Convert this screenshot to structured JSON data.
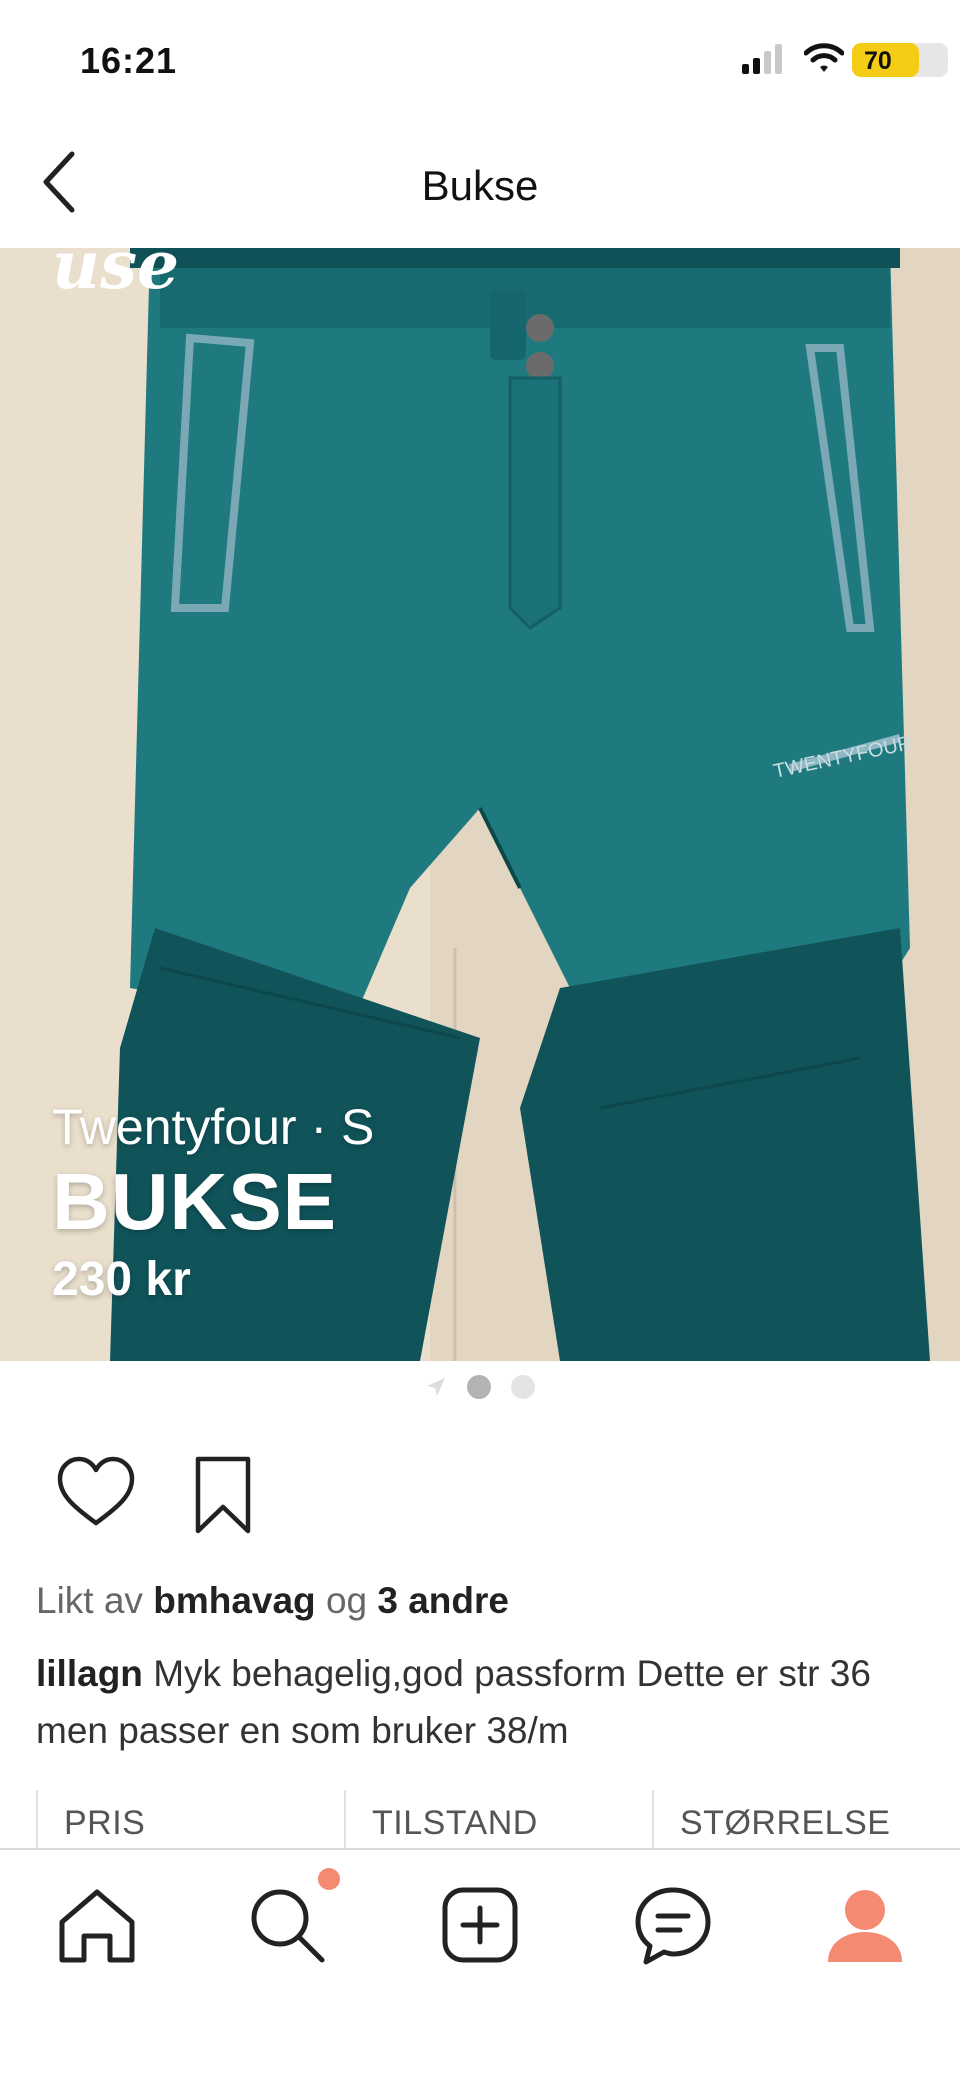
{
  "status_bar": {
    "time": "16:21",
    "battery": "70",
    "battery_level": 0.7,
    "icons": [
      "cellular-signal-icon",
      "wifi-icon",
      "battery-icon"
    ]
  },
  "header": {
    "title": "Bukse",
    "back_icon": "chevron-left-icon"
  },
  "listing": {
    "image_corner_text": "use",
    "brand_size": "Twentyfour · S",
    "title": "BUKSE",
    "price": "230 kr",
    "image_count": 2,
    "active_image_index": 0
  },
  "actions": {
    "like_icon": "heart-icon",
    "save_icon": "bookmark-icon"
  },
  "likes": {
    "prefix": "Likt av",
    "user": "bmhavag",
    "conjunction": "og",
    "others": "3 andre"
  },
  "caption": {
    "user": "lillagn",
    "text": "Myk behagelig,god passform Dette er str 36 men passer en som bruker 38/m"
  },
  "details": {
    "columns": [
      "PRIS",
      "TILSTAND",
      "STØRRELSE"
    ]
  },
  "tab_bar": {
    "items": [
      {
        "icon": "home-icon"
      },
      {
        "icon": "search-icon",
        "has_notification": true
      },
      {
        "icon": "add-icon"
      },
      {
        "icon": "messages-icon"
      },
      {
        "icon": "profile-icon"
      }
    ],
    "accent": "#f58a72"
  },
  "colors": {
    "battery_fill": "#f5cc15",
    "notification": "#f58a72",
    "pants_light": "#1f7a7f",
    "pants_dark": "#0f5157"
  }
}
